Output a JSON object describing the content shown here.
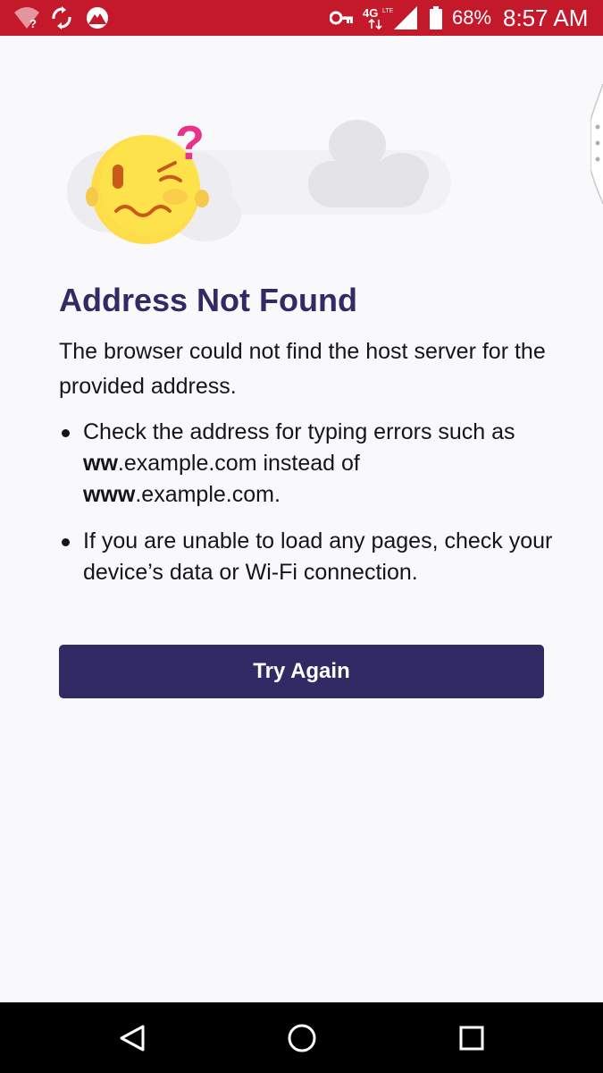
{
  "status_bar": {
    "icons": [
      "wifi-question-icon",
      "sync-icon",
      "vpn-mountain-icon",
      "key-icon",
      "network-4g-lte-icon",
      "signal-icon",
      "battery-icon"
    ],
    "network_label": "4G",
    "battery_percent": "68%",
    "time": "8:57 AM",
    "color": "#c4182b"
  },
  "error_page": {
    "title": "Address Not Found",
    "description": "The browser could not find the host server for the provided address.",
    "tips": {
      "tip1": {
        "prefix": "Check the address for typing errors such as ",
        "bold1": "ww",
        "middle": ".example.com instead of ",
        "bold2": "www",
        "suffix": ".example.com."
      },
      "tip2": {
        "text": "If you are unable to load any pages, check your device’s data or Wi-Fi connection."
      }
    },
    "button_label": "Try Again",
    "colors": {
      "title": "#312a65",
      "button": "#312a65",
      "text": "#15141a",
      "question_mark": "#e8328c",
      "face": "#fddd49"
    }
  },
  "nav_bar": {
    "buttons": [
      "back-triangle-icon",
      "home-circle-icon",
      "recents-square-icon"
    ]
  }
}
